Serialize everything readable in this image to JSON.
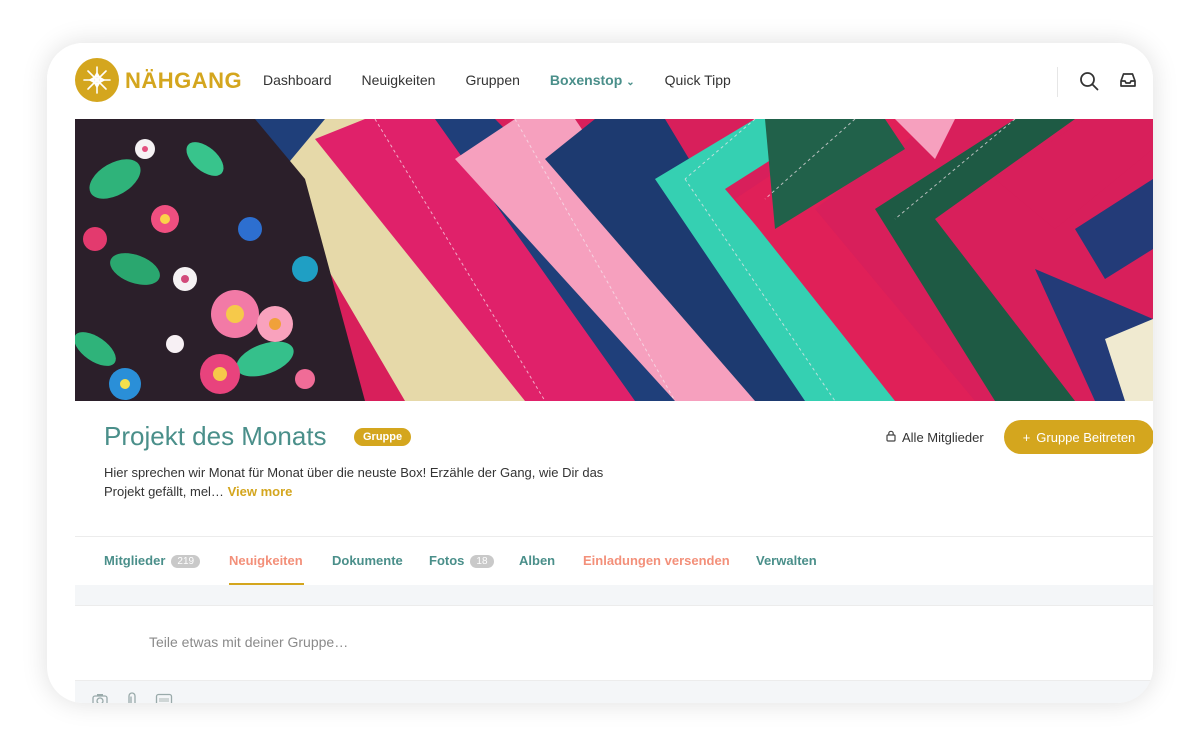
{
  "brand": {
    "name": "NÄHGANG",
    "accent": "#d4a61e",
    "teal": "#4a8f8a",
    "salmon": "#f3907a"
  },
  "nav": {
    "items": [
      {
        "label": "Dashboard",
        "active": false
      },
      {
        "label": "Neuigkeiten",
        "active": false
      },
      {
        "label": "Gruppen",
        "active": false
      },
      {
        "label": "Boxenstop",
        "active": true,
        "dropdown": true
      },
      {
        "label": "Quick Tipp",
        "active": false
      }
    ],
    "icons": [
      "search-icon",
      "inbox-icon"
    ]
  },
  "group": {
    "title": "Projekt des Monats",
    "badge": "Gruppe",
    "description": "Hier sprechen wir Monat für Monat über die neuste Box! Erzähle der Gang, wie Dir das Projekt gefällt, mel…",
    "view_more": "View more",
    "members_link": "Alle Mitglieder",
    "join_button": "Gruppe Beitreten"
  },
  "tabs": [
    {
      "label": "Mitglieder",
      "count": "219",
      "color": "#4a8f8a",
      "active": false
    },
    {
      "label": "Neuigkeiten",
      "color": "#f3907a",
      "active": true
    },
    {
      "label": "Dokumente",
      "color": "#4a8f8a",
      "active": false
    },
    {
      "label": "Fotos",
      "count": "18",
      "color": "#4a8f8a",
      "active": false
    },
    {
      "label": "Alben",
      "color": "#4a8f8a",
      "active": false
    },
    {
      "label": "Einladungen versenden",
      "color": "#f3907a",
      "active": false
    },
    {
      "label": "Verwalten",
      "color": "#4a8f8a",
      "active": false
    }
  ],
  "composer": {
    "placeholder": "Teile etwas mit deiner Gruppe…",
    "tools": [
      "camera-icon",
      "attachment-icon",
      "gif-icon"
    ]
  }
}
